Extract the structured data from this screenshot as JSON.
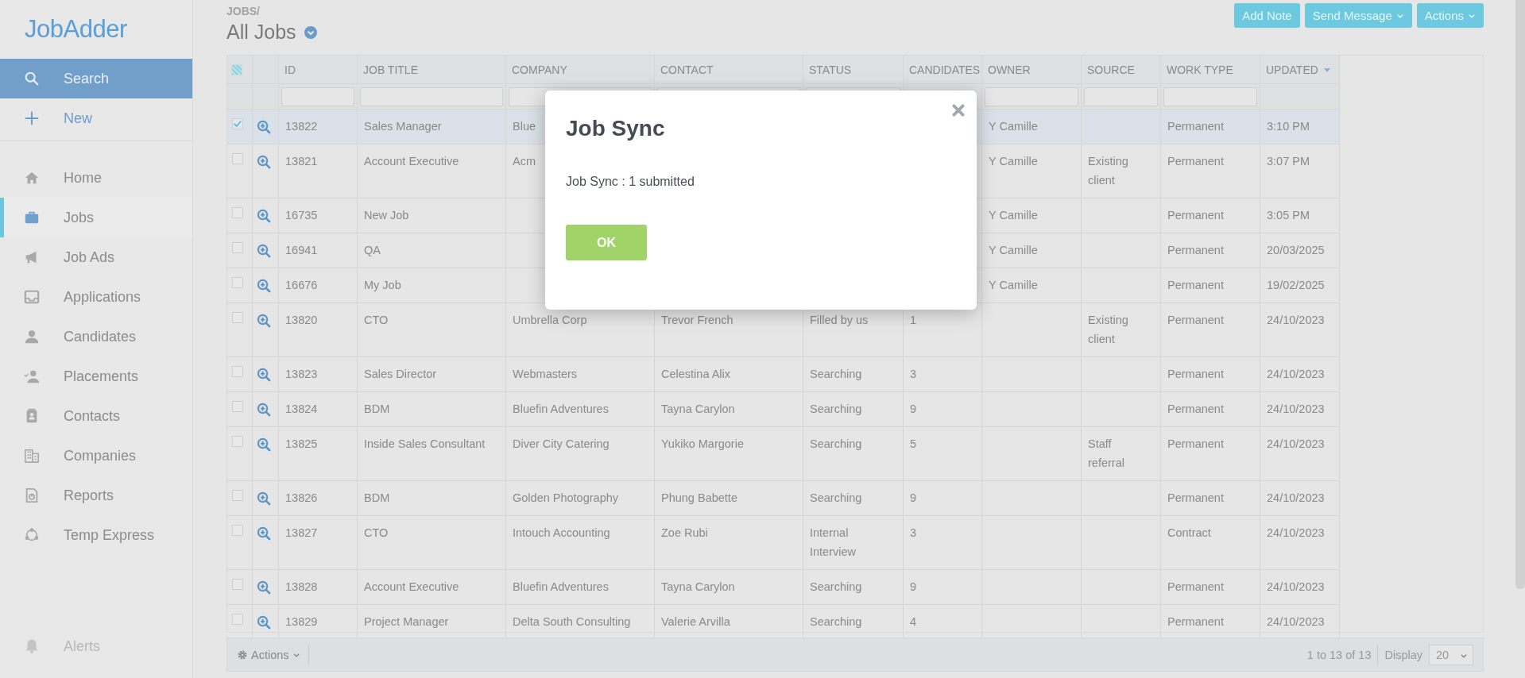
{
  "sidebar": {
    "logo": "JobAdder",
    "actions": [
      {
        "label": "Search",
        "selected": true
      },
      {
        "label": "New",
        "selected": false
      }
    ],
    "items": [
      {
        "label": "Home",
        "selected": false
      },
      {
        "label": "Jobs",
        "selected": true
      },
      {
        "label": "Job Ads",
        "selected": false
      },
      {
        "label": "Applications",
        "selected": false
      },
      {
        "label": "Candidates",
        "selected": false
      },
      {
        "label": "Placements",
        "selected": false
      },
      {
        "label": "Contacts",
        "selected": false
      },
      {
        "label": "Companies",
        "selected": false
      },
      {
        "label": "Reports",
        "selected": false
      },
      {
        "label": "Temp Express",
        "selected": false
      }
    ],
    "alerts": {
      "label": "Alerts",
      "disabled": true
    }
  },
  "header": {
    "breadcrumb": "JOBS/",
    "title": "All Jobs",
    "buttons": [
      {
        "label": "Add Note",
        "dropdown": false
      },
      {
        "label": "Send Message",
        "dropdown": true
      },
      {
        "label": "Actions",
        "dropdown": true
      }
    ]
  },
  "table": {
    "select_all": {
      "checked": false,
      "indeterminate": true
    },
    "columns": [
      {
        "label": "ID",
        "filter": true,
        "sorted": false
      },
      {
        "label": "JOB TITLE",
        "filter": true,
        "sorted": false
      },
      {
        "label": "COMPANY",
        "filter": true,
        "sorted": false
      },
      {
        "label": "CONTACT",
        "filter": true,
        "sorted": false
      },
      {
        "label": "STATUS",
        "filter": true,
        "sorted": false
      },
      {
        "label": "CANDIDATES",
        "filter": false,
        "sorted": false
      },
      {
        "label": "OWNER",
        "filter": true,
        "sorted": false
      },
      {
        "label": "SOURCE",
        "filter": true,
        "sorted": false
      },
      {
        "label": "WORK TYPE",
        "filter": true,
        "sorted": false
      },
      {
        "label": "UPDATED",
        "filter": false,
        "sorted": true
      }
    ],
    "rows": [
      {
        "selected": true,
        "cells": [
          "13822",
          "Sales Manager",
          "Blue",
          null,
          null,
          null,
          "Y Camille",
          null,
          "Permanent",
          "3:10 PM"
        ]
      },
      {
        "selected": false,
        "cells": [
          "13821",
          "Account Executive",
          "Acm",
          null,
          null,
          null,
          "Y Camille",
          "Existing client",
          "Permanent",
          "3:07 PM"
        ]
      },
      {
        "selected": false,
        "cells": [
          "16735",
          "New Job",
          null,
          null,
          null,
          null,
          "Y Camille",
          null,
          "Permanent",
          "3:05 PM"
        ]
      },
      {
        "selected": false,
        "cells": [
          "16941",
          "QA",
          null,
          null,
          null,
          null,
          "Y Camille",
          null,
          "Permanent",
          "20/03/2025"
        ]
      },
      {
        "selected": false,
        "cells": [
          "16676",
          "My Job",
          null,
          null,
          null,
          null,
          "Y Camille",
          null,
          "Permanent",
          "19/02/2025"
        ]
      },
      {
        "selected": false,
        "cells": [
          "13820",
          "CTO",
          "Umbrella Corp",
          "Trevor French",
          "Filled by us",
          "1",
          null,
          "Existing client",
          "Permanent",
          "24/10/2023"
        ]
      },
      {
        "selected": false,
        "cells": [
          "13823",
          "Sales Director",
          "Webmasters",
          "Celestina Alix",
          "Searching",
          "3",
          null,
          null,
          "Permanent",
          "24/10/2023"
        ]
      },
      {
        "selected": false,
        "cells": [
          "13824",
          "BDM",
          "Bluefin Adventures",
          "Tayna Carylon",
          "Searching",
          "9",
          null,
          null,
          "Permanent",
          "24/10/2023"
        ]
      },
      {
        "selected": false,
        "cells": [
          "13825",
          "Inside Sales Consultant",
          "Diver City Catering",
          "Yukiko Margorie",
          "Searching",
          "5",
          null,
          "Staff referral",
          "Permanent",
          "24/10/2023"
        ]
      },
      {
        "selected": false,
        "cells": [
          "13826",
          "BDM",
          "Golden Photography",
          "Phung Babette",
          "Searching",
          "9",
          null,
          null,
          "Permanent",
          "24/10/2023"
        ]
      },
      {
        "selected": false,
        "cells": [
          "13827",
          "CTO",
          "Intouch Accounting",
          "Zoe Rubi",
          "Internal Interview",
          "3",
          null,
          null,
          "Contract",
          "24/10/2023"
        ]
      },
      {
        "selected": false,
        "cells": [
          "13828",
          "Account Executive",
          "Bluefin Adventures",
          "Tayna Carylon",
          "Searching",
          "9",
          null,
          null,
          "Permanent",
          "24/10/2023"
        ]
      },
      {
        "selected": false,
        "cells": [
          "13829",
          "Project Manager",
          "Delta South Consulting",
          "Valerie Arvilla",
          "Searching",
          "4",
          null,
          null,
          "Permanent",
          "24/10/2023"
        ]
      }
    ]
  },
  "footer": {
    "actions": "Actions",
    "range": "1 to 13 of 13",
    "display_label": "Display",
    "display_value": "20"
  },
  "dialog": {
    "title": "Job Sync",
    "message": "Job Sync : 1 submitted",
    "button": "OK"
  }
}
